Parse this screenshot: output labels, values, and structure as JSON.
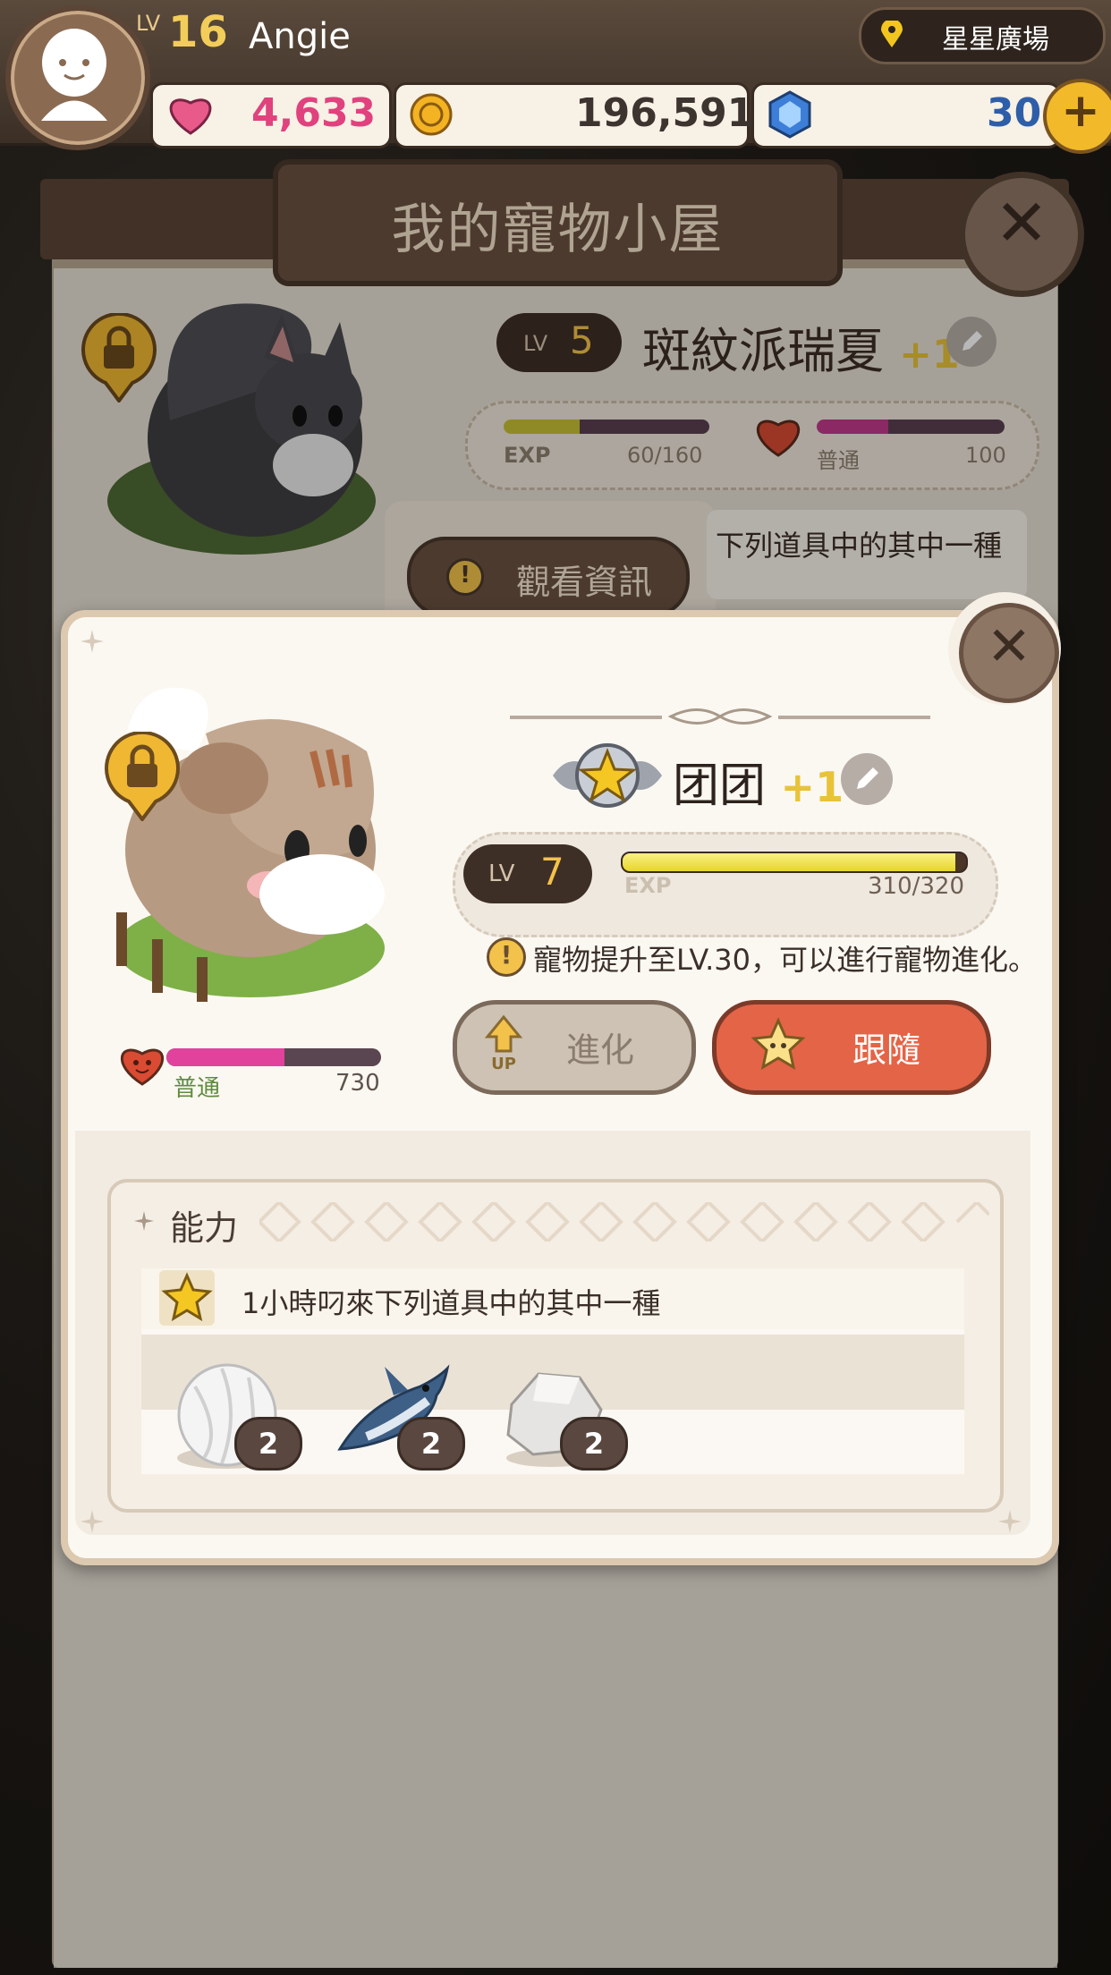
{
  "header": {
    "level_label": "LV",
    "level": "16",
    "username": "Angie",
    "location": "星星廣場",
    "hearts": "4,633",
    "coins": "196,591",
    "gems": "30",
    "add_symbol": "+"
  },
  "house": {
    "title": "我的寵物小屋",
    "close_symbol": "✕",
    "back_pet": {
      "level_label": "LV",
      "level": "5",
      "name": "斑紋派瑞夏",
      "bonus": "+1",
      "exp_label": "EXP",
      "exp_value": "60/160",
      "mood_label": "普通",
      "mood_value": "100",
      "view_info": "觀看資訊",
      "desc_partial": "下列道具中的其中一種"
    }
  },
  "popup": {
    "close_symbol": "✕",
    "pet_name": "团团",
    "bonus": "+1",
    "level_label": "LV",
    "level": "7",
    "exp_label": "EXP",
    "exp_value": "310/320",
    "exp_progress": 0.97,
    "notice": "寵物提升至LV.30，可以進行寵物進化。",
    "evolve_button": "進化",
    "evolve_badge": "UP",
    "follow_button": "跟隨",
    "mood_label": "普通",
    "mood_value": "730",
    "mood_progress": 0.55,
    "ability_title": "能力",
    "ability_desc": "1小時叼來下列道具中的其中一種",
    "items": [
      {
        "name": "cotton-ball-icon",
        "count": "2"
      },
      {
        "name": "shark-icon",
        "count": "2"
      },
      {
        "name": "stone-icon",
        "count": "2"
      }
    ]
  },
  "colors": {
    "hearts": "#e0427e",
    "gems": "#2f5ea8",
    "follow": "#e46447",
    "exp": "#e6d52d"
  }
}
